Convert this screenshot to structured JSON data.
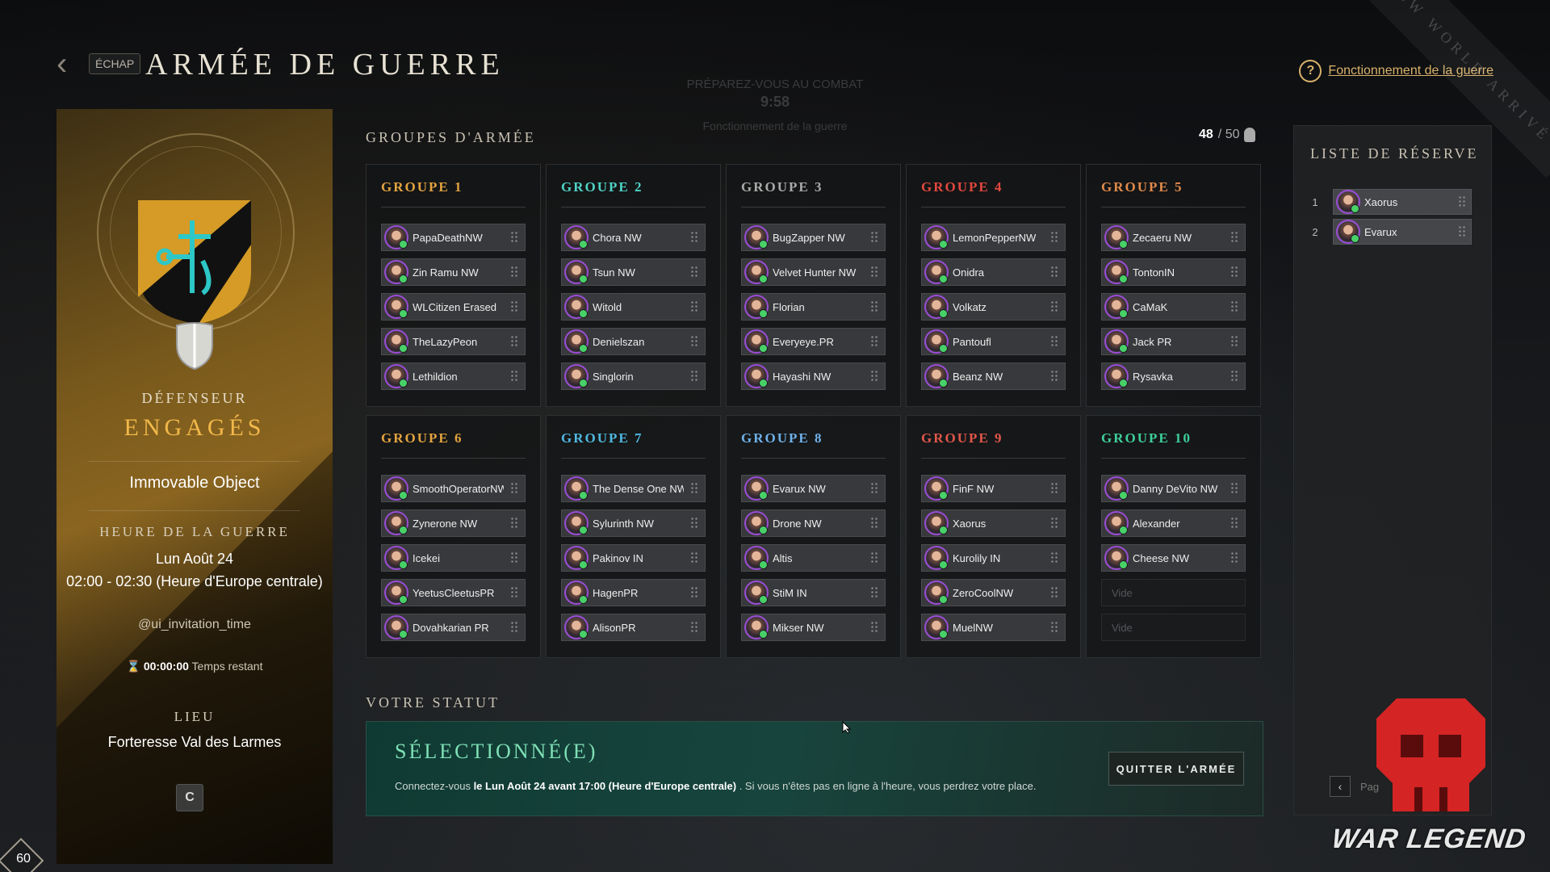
{
  "header": {
    "escape_label": "ÉCHAP",
    "title": "ARMÉE DE GUERRE",
    "ghost_line1": "PRÉPAREZ-VOUS AU COMBAT",
    "ghost_line2": "9:58",
    "ghost_line3": "Fonctionnement de la guerre",
    "help_label": "Fonctionnement de la guerre",
    "corner_text": "NEW WORLD ARRIVÉ"
  },
  "left": {
    "role": "DÉFENSEUR",
    "status": "ENGAGÉS",
    "company": "Immovable Object",
    "war_time_label": "HEURE DE LA GUERRE",
    "date": "Lun Août 24",
    "time": "02:00 - 02:30  (Heure d'Europe centrale)",
    "invitation": "@ui_invitation_time",
    "remaining_value": "00:00:00",
    "remaining_label": "Temps restant",
    "location_label": "LIEU",
    "location": "Forteresse Val des Larmes",
    "refresh_label": "C",
    "level": "60"
  },
  "groups_section": {
    "title": "GROUPES D'ARMÉE",
    "count": "48",
    "max": "/ 50"
  },
  "groups": [
    {
      "title": "GROUPE 1",
      "color": "#e2a340",
      "members": [
        "PapaDeathNW",
        "Zin Ramu NW",
        "WLCitizen Erased",
        "TheLazyPeon",
        "Lethildion"
      ]
    },
    {
      "title": "GROUPE 2",
      "color": "#4fd1c5",
      "members": [
        "Chora NW",
        "Tsun NW",
        "Witold",
        "Denielszan",
        "Singlorin"
      ]
    },
    {
      "title": "GROUPE 3",
      "color": "#a9a9a9",
      "members": [
        "BugZapper NW",
        "Velvet Hunter NW",
        "Florian",
        "Everyeye.PR",
        "Hayashi NW"
      ]
    },
    {
      "title": "GROUPE 4",
      "color": "#e0483e",
      "members": [
        "LemonPepperNW",
        "Onidra",
        "Volkatz",
        "Pantoufl",
        "Beanz NW"
      ]
    },
    {
      "title": "GROUPE 5",
      "color": "#e08a4a",
      "members": [
        "Zecaeru NW",
        "TontonIN",
        "CaMaK",
        "Jack PR",
        "Rysavka"
      ]
    },
    {
      "title": "GROUPE 6",
      "color": "#e2a340",
      "members": [
        "SmoothOperatorNW",
        "Zynerone NW",
        "Icekei",
        "YeetusCleetusPR",
        "Dovahkarian PR"
      ]
    },
    {
      "title": "GROUPE 7",
      "color": "#4fb8e0",
      "members": [
        "The Dense One NW",
        "Sylurinth NW",
        "Pakinov IN",
        "HagenPR",
        "AlisonPR"
      ]
    },
    {
      "title": "GROUPE 8",
      "color": "#6fb0e8",
      "members": [
        "Evarux NW",
        "Drone NW",
        "Altis",
        "StiM IN",
        "Mikser NW"
      ]
    },
    {
      "title": "GROUPE 9",
      "color": "#e0574a",
      "members": [
        "FinF NW",
        "Xaorus",
        "Kurolily IN",
        "ZeroCoolNW",
        "MuelNW"
      ]
    },
    {
      "title": "GROUPE 10",
      "color": "#3ecf9a",
      "members": [
        "Danny DeVito NW",
        "Alexander",
        "Cheese NW"
      ],
      "empty": [
        "Vide",
        "Vide"
      ]
    }
  ],
  "status": {
    "section_title": "VOTRE STATUT",
    "title": "SÉLECTIONNÉ(E)",
    "text_pre": "Connectez-vous ",
    "text_bold": "le Lun Août 24 avant 17:00  (Heure d'Europe centrale)",
    "text_post": " . Si vous n'êtes pas en ligne à l'heure, vous perdrez votre place.",
    "quit_label": "QUITTER L'ARMÉE"
  },
  "reserve": {
    "title": "LISTE DE RÉSERVE",
    "items": [
      {
        "num": "1",
        "name": "Xaorus"
      },
      {
        "num": "2",
        "name": "Evarux"
      }
    ],
    "page_label": "Pag"
  },
  "watermark": "WAR LEGEND"
}
